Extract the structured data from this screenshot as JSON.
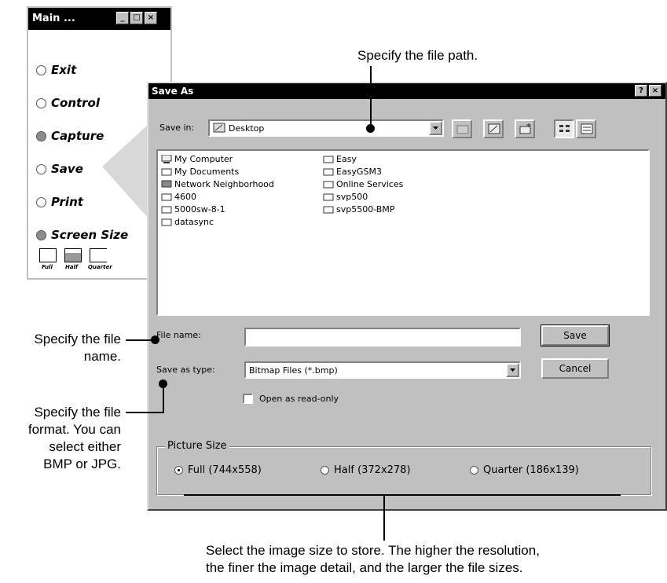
{
  "main_window": {
    "title": "Main ...",
    "options": [
      "Exit",
      "Control",
      "Capture",
      "Save",
      "Print",
      "Screen Size"
    ],
    "size_icons": [
      "Full",
      "Half",
      "Quarter"
    ]
  },
  "dialog": {
    "title": "Save As",
    "help_glyph": "?",
    "close_glyph": "×",
    "save_in_label": "Save in:",
    "save_in_value": "Desktop",
    "files_col1": [
      "My Computer",
      "My Documents",
      "Network Neighborhood",
      "4600",
      "5000sw-8-1",
      "datasync"
    ],
    "files_col2": [
      "Easy",
      "EasyGSM3",
      "Online Services",
      "svp500",
      "svp5500-BMP"
    ],
    "file_name_label": "File name:",
    "file_name_value": "",
    "save_type_label": "Save as type:",
    "save_type_value": "Bitmap Files (*.bmp)",
    "readonly_label": "Open as read-only",
    "save_button": "Save",
    "cancel_button": "Cancel",
    "picture_size_legend": "Picture Size",
    "picture_sizes": [
      "Full (744x558)",
      "Half (372x278)",
      "Quarter (186x139)"
    ],
    "selected_picture_size": "Full (744x558)"
  },
  "annotations": {
    "path": "Specify the file path.",
    "name_line1": "Specify the file",
    "name_line2": "name.",
    "format_line1": "Specify the file",
    "format_line2": "format. You can",
    "format_line3": "select either",
    "format_line4": "BMP or JPG.",
    "size_line1": "Select the image size to store. The higher the resolution,",
    "size_line2": "the finer the image detail, and the larger the file sizes."
  }
}
